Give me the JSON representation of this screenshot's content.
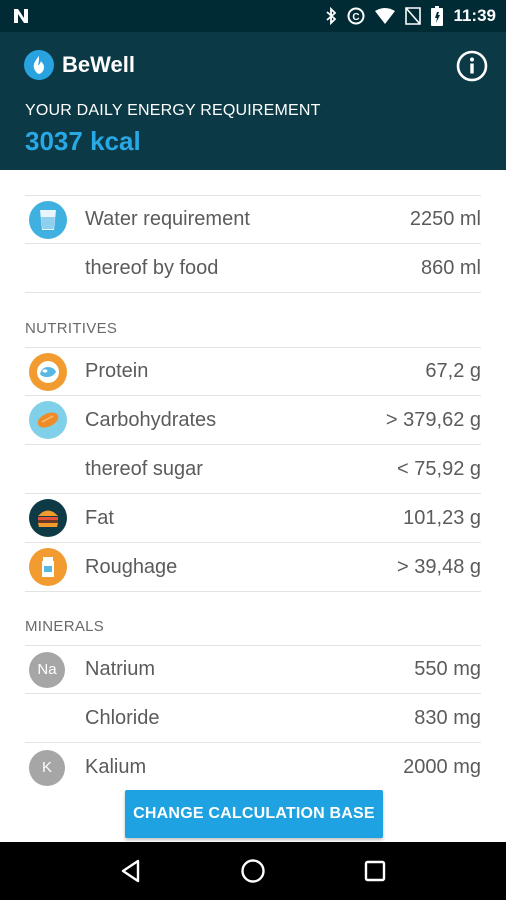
{
  "status_bar": {
    "time": "11:39",
    "icons": [
      "n-notification-icon",
      "bluetooth-icon",
      "sync-icon",
      "wifi-icon",
      "no-sim-icon",
      "battery-icon"
    ]
  },
  "header": {
    "app_name": "BeWell",
    "requirement_label": "YOUR DAILY ENERGY REQUIREMENT",
    "requirement_value": "3037 kcal",
    "info_icon": "info-icon"
  },
  "water": [
    {
      "label": "Water requirement",
      "value": "2250 ml",
      "icon": "water-glass-icon"
    },
    {
      "label": "thereof by food",
      "value": "860 ml",
      "icon": ""
    }
  ],
  "nutritives": {
    "title": "NUTRITIVES",
    "items": [
      {
        "label": "Protein",
        "value": "67,2 g",
        "icon": "protein-icon"
      },
      {
        "label": "Carbohydrates",
        "value": "> 379,62 g",
        "icon": "carbohydrates-icon"
      },
      {
        "label": "thereof sugar",
        "value": "< 75,92 g",
        "icon": ""
      },
      {
        "label": "Fat",
        "value": "101,23 g",
        "icon": "burger-icon"
      },
      {
        "label": "Roughage",
        "value": "> 39,48 g",
        "icon": "roughage-icon"
      }
    ]
  },
  "minerals": {
    "title": "MINERALS",
    "items": [
      {
        "label": "Natrium",
        "value": "550 mg",
        "icon_text": "Na"
      },
      {
        "label": "Chloride",
        "value": "830 mg",
        "icon_text": ""
      },
      {
        "label": "Kalium",
        "value": "2000 mg",
        "icon_text": "K"
      }
    ]
  },
  "action": {
    "change_label": "CHANGE CALCULATION BASE"
  },
  "colors": {
    "status_bar": "#002b34",
    "header": "#0b3a46",
    "accent": "#1ea2e2",
    "kcal": "#29a8e6"
  }
}
